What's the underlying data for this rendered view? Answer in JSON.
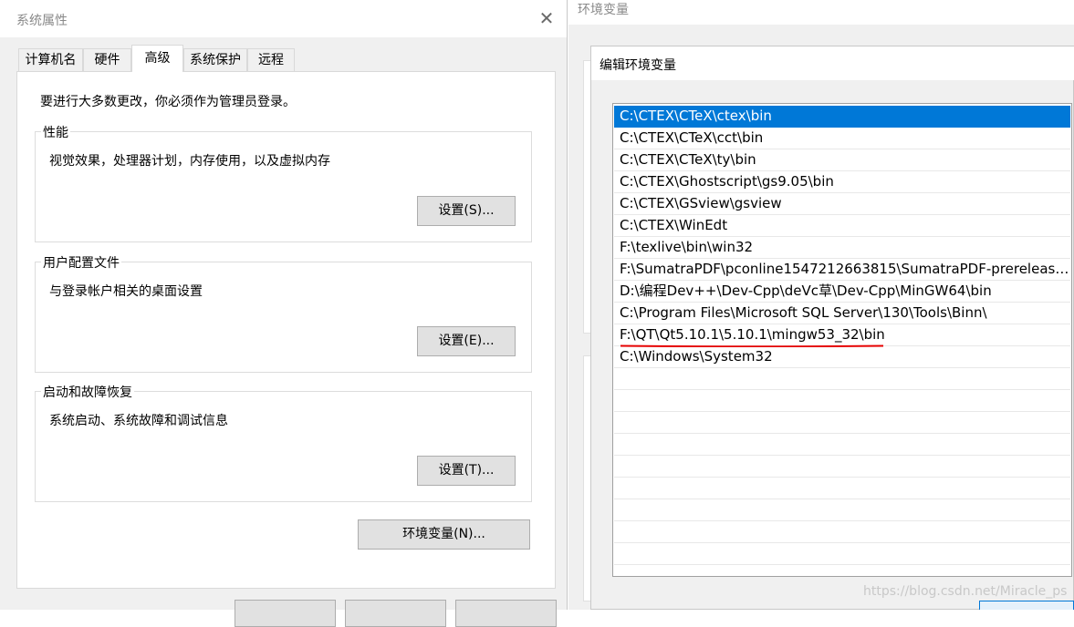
{
  "system_properties": {
    "title": "系统属性",
    "close_glyph": "✕",
    "tabs": [
      {
        "label": "计算机名"
      },
      {
        "label": "硬件"
      },
      {
        "label": "高级"
      },
      {
        "label": "系统保护"
      },
      {
        "label": "远程"
      }
    ],
    "active_tab": "高级",
    "admin_note": "要进行大多数更改，你必须作为管理员登录。",
    "performance": {
      "legend": "性能",
      "description": "视觉效果，处理器计划，内存使用，以及虚拟内存",
      "button": "设置(S)..."
    },
    "user_profiles": {
      "legend": "用户配置文件",
      "description": "与登录帐户相关的桌面设置",
      "button": "设置(E)..."
    },
    "startup_recovery": {
      "legend": "启动和故障恢复",
      "description": "系统启动、系统故障和调试信息",
      "button": "设置(T)..."
    },
    "env_vars_button": "环境变量(N)..."
  },
  "environment_variables": {
    "title": "环境变量"
  },
  "edit_env_var": {
    "title": "编辑环境变量",
    "selected_index": 0,
    "underlined_index": 10,
    "entries": [
      "C:\\CTEX\\CTeX\\ctex\\bin",
      "C:\\CTEX\\CTeX\\cct\\bin",
      "C:\\CTEX\\CTeX\\ty\\bin",
      "C:\\CTEX\\Ghostscript\\gs9.05\\bin",
      "C:\\CTEX\\GSview\\gsview",
      "C:\\CTEX\\WinEdt",
      "F:\\texlive\\bin\\win32",
      "F:\\SumatraPDF\\pconline1547212663815\\SumatraPDF-prerelease-...",
      "D:\\编程Dev++\\Dev-Cpp\\deVc草\\Dev-Cpp\\MinGW64\\bin",
      "C:\\Program Files\\Microsoft SQL Server\\130\\Tools\\Binn\\",
      "F:\\QT\\Qt5.10.1\\5.10.1\\mingw53_32\\bin",
      "C:\\Windows\\System32"
    ]
  },
  "watermark": "https://blog.csdn.net/Miracle_ps",
  "colors": {
    "selection": "#0078d7",
    "annotation_red": "#e60000",
    "dialog_bg": "#f0f0f0"
  }
}
